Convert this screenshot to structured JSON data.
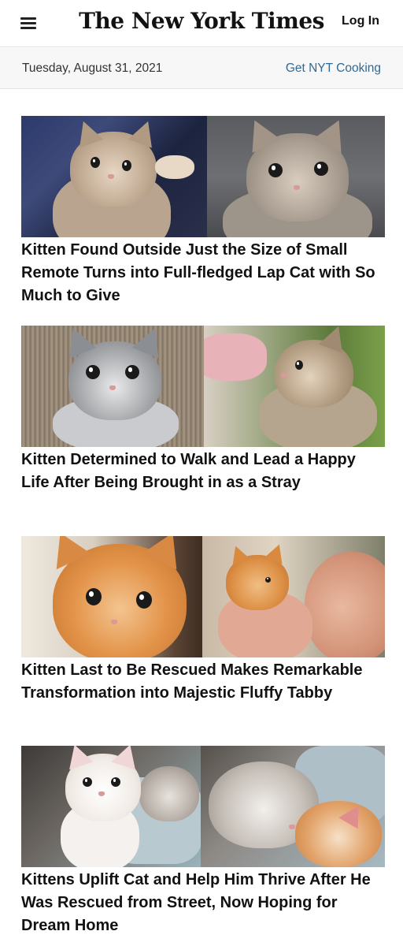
{
  "header": {
    "menu_icon": "hamburger-menu-icon",
    "logo_text": "The New York Times",
    "login_label": "Log In"
  },
  "subheader": {
    "date": "Tuesday, August 31, 2021",
    "cooking_link": "Get NYT Cooking"
  },
  "colors": {
    "link_blue": "#326891",
    "headline": "#121212",
    "datebar_bg": "#f7f7f7"
  },
  "articles": [
    {
      "headline": "Kitten Found Outside Just the Size of Small Remote Turns into Full-fledged Lap Cat with So Much to Give"
    },
    {
      "headline": "Kitten Determined to Walk and Lead a Happy Life After Being Brought in as a Stray"
    },
    {
      "headline": "Kitten Last to Be Rescued Makes Remarkable Transformation into Majestic Fluffy Tabby"
    },
    {
      "headline": "Kittens Uplift Cat and Help Him Thrive After He Was Rescued from Street, Now Hoping for Dream Home"
    }
  ]
}
